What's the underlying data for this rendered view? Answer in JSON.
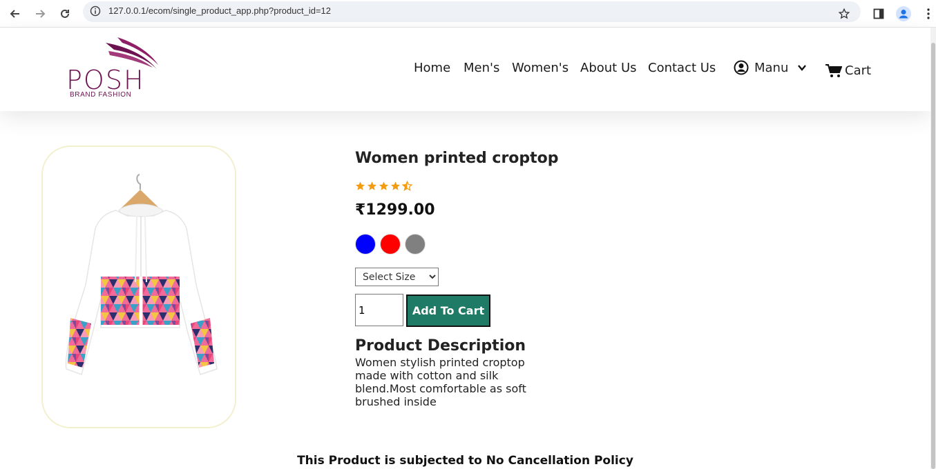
{
  "browser": {
    "url": "127.0.0.1/ecom/single_product_app.php?product_id=12"
  },
  "header": {
    "logo": {
      "text": "POSH",
      "subtext": "BRAND FASHION"
    },
    "nav": [
      "Home",
      "Men's",
      "Women's",
      "About Us",
      "Contact Us"
    ],
    "menu_label": "Manu",
    "cart_label": "Cart"
  },
  "product": {
    "title": "Women printed croptop",
    "rating": 4.5,
    "price": "₹1299.00",
    "colors": [
      "#0000ff",
      "#ff0000",
      "#808080"
    ],
    "size_select": {
      "selected": "Select Size"
    },
    "quantity": "1",
    "add_to_cart_label": "Add To Cart",
    "description_heading": "Product Description",
    "description": "Women stylish printed croptop made with cotton and silk blend.Most comfortable as soft brushed inside"
  },
  "footer_note": "This Product is subjected to No Cancellation Policy",
  "colors": {
    "brand": "#6d1250",
    "button": "#1f7a66",
    "star": "#f39c12"
  },
  "icons": {
    "back": "arrow-left-icon",
    "forward": "arrow-right-icon",
    "reload": "reload-icon",
    "info": "info-icon",
    "bookmark": "star-icon",
    "sidepanel": "side-panel-icon",
    "profile": "profile-icon",
    "more": "more-vertical-icon",
    "user": "user-circle-icon",
    "cart": "shopping-cart-icon"
  }
}
